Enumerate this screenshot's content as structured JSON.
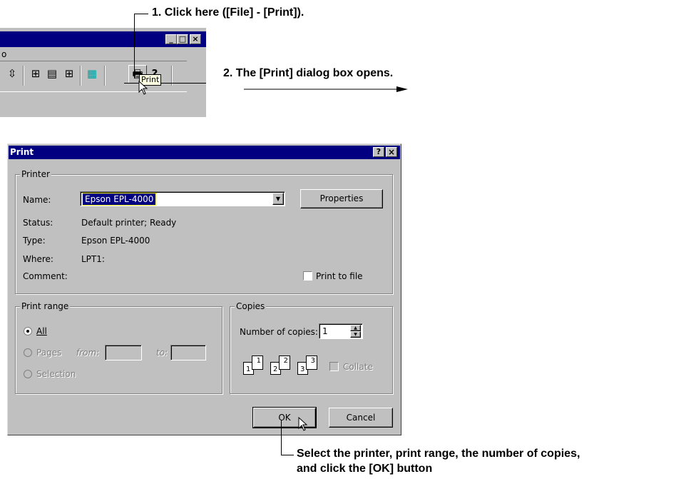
{
  "callouts": {
    "step1": "1. Click here ([File] - [Print]).",
    "step2": "2. The [Print] dialog box opens.",
    "step3_line1": "Select the printer, print range, the number of copies,",
    "step3_line2": "and click the [OK] button"
  },
  "top_window": {
    "menu_fragment": "o",
    "tooltip": "Print",
    "caption_buttons": [
      "_",
      "□",
      "×"
    ]
  },
  "dialog": {
    "title": "Print",
    "title_buttons": [
      "?",
      "×"
    ],
    "printer": {
      "group_label": "Printer",
      "name_label": "Name:",
      "name_value": "Epson EPL-4000",
      "properties_button": "Properties",
      "status_label": "Status:",
      "status_value": "Default printer; Ready",
      "type_label": "Type:",
      "type_value": "Epson EPL-4000",
      "where_label": "Where:",
      "where_value": "LPT1:",
      "comment_label": "Comment:",
      "print_to_file_label": "Print to file",
      "print_to_file_checked": false
    },
    "print_range": {
      "group_label": "Print range",
      "all_label": "All",
      "pages_label": "Pages",
      "from_label": "from:",
      "to_label": "to:",
      "selection_label": "Selection",
      "selected": "All"
    },
    "copies": {
      "group_label": "Copies",
      "number_label": "Number of copies:",
      "number_value": "1",
      "collate_label": "Collate",
      "collate_checked": false,
      "page_numbers": [
        "1",
        "1",
        "2",
        "2",
        "3",
        "3"
      ]
    },
    "ok_button": "OK",
    "cancel_button": "Cancel"
  }
}
